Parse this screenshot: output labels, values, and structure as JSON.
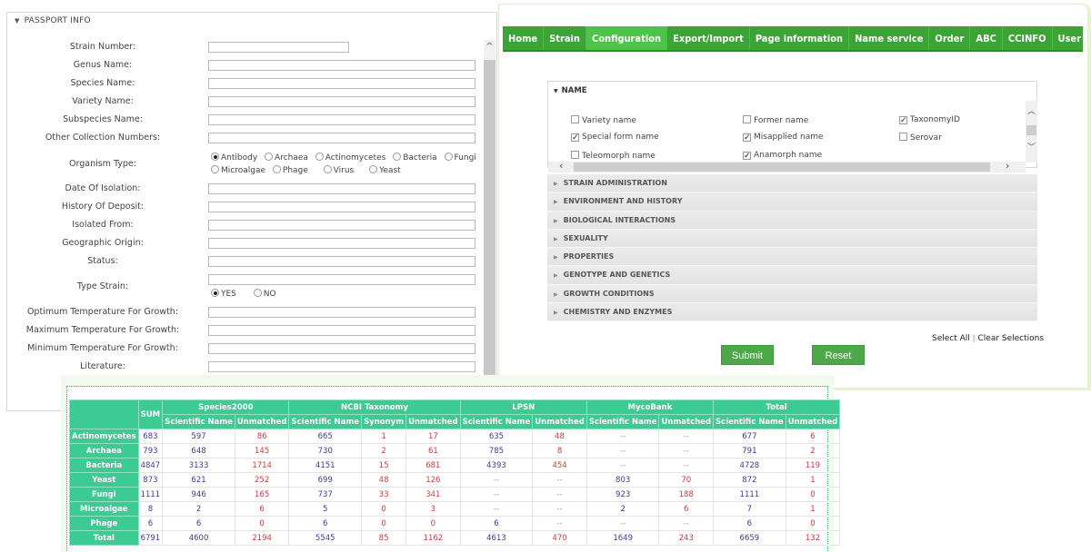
{
  "passport": {
    "title": "PASSPORT INFO",
    "fields": [
      {
        "label": "Strain Number:",
        "value": ""
      },
      {
        "label": "Genus Name:",
        "value": ""
      },
      {
        "label": "Species Name:",
        "value": ""
      },
      {
        "label": "Variety Name:",
        "value": ""
      },
      {
        "label": "Subspecies Name:",
        "value": ""
      },
      {
        "label": "Other Collection Numbers:",
        "value": ""
      }
    ],
    "organism_type": {
      "label": "Organism Type:",
      "options": [
        "Antibody",
        "Archaea",
        "Actinomycetes",
        "Bacteria",
        "Fungi",
        "Microalgae",
        "Phage",
        "Virus",
        "Yeast"
      ],
      "selected": "Antibody"
    },
    "fields2": [
      {
        "label": "Date Of Isolation:",
        "value": ""
      },
      {
        "label": "History Of Deposit:",
        "value": ""
      },
      {
        "label": "Isolated From:",
        "value": ""
      },
      {
        "label": "Geographic Origin:",
        "value": ""
      },
      {
        "label": "Status:",
        "value": ""
      }
    ],
    "type_strain": {
      "label": "Type Strain:",
      "value": "",
      "options": [
        "YES",
        "NO"
      ],
      "selected": "YES"
    },
    "fields3": [
      {
        "label": "Optimum Temperature For Growth:",
        "value": ""
      },
      {
        "label": "Maximum Temperature For Growth:",
        "value": ""
      },
      {
        "label": "Minimum Temperature For Growth:",
        "value": ""
      },
      {
        "label": "Literature:",
        "value": ""
      }
    ],
    "scroll_up_glyph": "^"
  },
  "config": {
    "nav": [
      "Home",
      "Strain",
      "Configuration",
      "Export/Import",
      "Page information",
      "Name service",
      "Order",
      "ABC",
      "CCINFO",
      "User"
    ],
    "active_tab": "Configuration",
    "name_section": {
      "title": "NAME",
      "options": [
        {
          "label": "Variety name",
          "checked": false
        },
        {
          "label": "Former name",
          "checked": false
        },
        {
          "label": "TaxonomyID",
          "checked": true
        },
        {
          "label": "Special form name",
          "checked": true
        },
        {
          "label": "Misapplied name",
          "checked": true
        },
        {
          "label": "Serovar",
          "checked": false
        },
        {
          "label": "Teleomorph name",
          "checked": false
        },
        {
          "label": "Anamorph name",
          "checked": true
        }
      ]
    },
    "sections": [
      "STRAIN ADMINISTRATION",
      "ENVIRONMENT AND HISTORY",
      "BIOLOGICAL INTERACTIONS",
      "SEXUALITY",
      "PROPERTIES",
      "GENOTYPE AND GENETICS",
      "GROWTH CONDITIONS",
      "CHEMISTRY AND ENZYMES"
    ],
    "select_all": "Select All",
    "separator": "|",
    "clear_selections": "Clear Selections",
    "submit": "Submit",
    "reset": "Reset"
  },
  "stats": {
    "sum_header": "SUM",
    "groups": [
      {
        "name": "Species2000",
        "cols": [
          "Scientific Name",
          "Unmatched"
        ]
      },
      {
        "name": "NCBI Taxonomy",
        "cols": [
          "Scientific Name",
          "Synonym",
          "Unmatched"
        ]
      },
      {
        "name": "LPSN",
        "cols": [
          "Scientific Name",
          "Unmatched"
        ]
      },
      {
        "name": "MycoBank",
        "cols": [
          "Scientific Name",
          "Unmatched"
        ]
      },
      {
        "name": "Total",
        "cols": [
          "Scientific Name",
          "Unmatched"
        ]
      }
    ],
    "col_colors": [
      "b",
      "b",
      "r",
      "b",
      "r",
      "r",
      "b",
      "r",
      "b",
      "r",
      "b",
      "r"
    ],
    "rows": [
      {
        "name": "Actinomycetes",
        "values": [
          "683",
          "597",
          "86",
          "665",
          "1",
          "17",
          "635",
          "48",
          "--",
          "--",
          "677",
          "6"
        ]
      },
      {
        "name": "Archaea",
        "values": [
          "793",
          "648",
          "145",
          "730",
          "2",
          "61",
          "785",
          "8",
          "--",
          "--",
          "791",
          "2"
        ]
      },
      {
        "name": "Bacteria",
        "values": [
          "4847",
          "3133",
          "1714",
          "4151",
          "15",
          "681",
          "4393",
          "454",
          "--",
          "--",
          "4728",
          "119"
        ]
      },
      {
        "name": "Yeast",
        "values": [
          "873",
          "621",
          "252",
          "699",
          "48",
          "126",
          "--",
          "--",
          "803",
          "70",
          "872",
          "1"
        ]
      },
      {
        "name": "Fungi",
        "values": [
          "1111",
          "946",
          "165",
          "737",
          "33",
          "341",
          "--",
          "--",
          "923",
          "188",
          "1111",
          "0"
        ]
      },
      {
        "name": "Microalgae",
        "values": [
          "8",
          "2",
          "6",
          "5",
          "0",
          "3",
          "--",
          "--",
          "2",
          "6",
          "7",
          "1"
        ]
      },
      {
        "name": "Phage",
        "values": [
          "6",
          "6",
          "0",
          "6",
          "0",
          "0",
          "6",
          "--",
          "--",
          "--",
          "6",
          "0"
        ]
      },
      {
        "name": "Total",
        "values": [
          "6791",
          "4600",
          "2194",
          "5545",
          "85",
          "1162",
          "4613",
          "470",
          "1649",
          "243",
          "6659",
          "132"
        ]
      }
    ]
  }
}
